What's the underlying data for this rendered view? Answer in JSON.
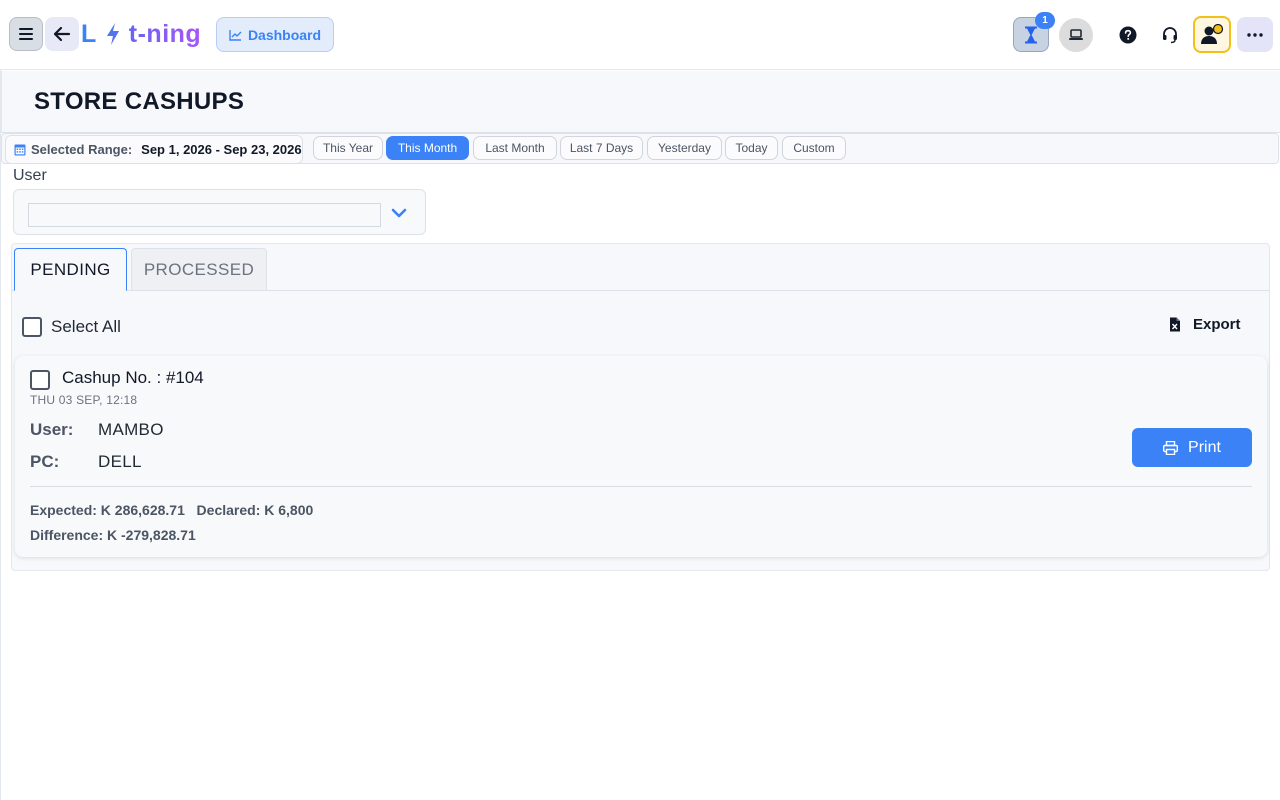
{
  "app": {
    "logo_part1": "L",
    "logo_part2": "t-ning",
    "dashboard_label": "Dashboard",
    "queue_badge": "1"
  },
  "icons": {
    "menu": "hamburger-icon",
    "back": "arrow-left-icon",
    "logo": "bolt-icon",
    "dashboard": "chart-line-icon",
    "queue": "hourglass-icon",
    "device": "laptop-icon",
    "help": "question-circle-icon",
    "support": "headset-icon",
    "user": "user-status-icon",
    "more": "ellipsis-icon",
    "calendar": "calendar-icon",
    "dropdown": "chevron-down-icon",
    "export": "excel-file-icon",
    "print": "printer-icon"
  },
  "colors": {
    "accent": "#3b82f6",
    "logo_gradient_start": "#6a63f2",
    "logo_gradient_end": "#a855f7",
    "user_status": "#f2c01c"
  },
  "page": {
    "title": "STORE CASHUPS"
  },
  "range": {
    "label": "Selected Range:",
    "value": "Sep 1, 2026 - Sep 23, 2026",
    "chips": [
      {
        "label": "This Year",
        "active": false
      },
      {
        "label": "This Month",
        "active": true
      },
      {
        "label": "Last Month",
        "active": false
      },
      {
        "label": "Last 7 Days",
        "active": false
      },
      {
        "label": "Yesterday",
        "active": false
      },
      {
        "label": "Today",
        "active": false
      },
      {
        "label": "Custom",
        "active": false
      }
    ]
  },
  "filter": {
    "user_label": "User",
    "user_value": "",
    "user_placeholder": ""
  },
  "tabs": [
    {
      "label": "PENDING",
      "active": true
    },
    {
      "label": "PROCESSED",
      "active": false
    }
  ],
  "list": {
    "select_all_label": "Select All",
    "export_label": "Export"
  },
  "cashup": {
    "title": "Cashup No. : #104",
    "date": "THU 03 SEP, 12:18",
    "user_key": "User:",
    "user_value": "MAMBO",
    "pc_key": "PC:",
    "pc_value": "DELL",
    "expected": "Expected: K 286,628.71",
    "declared": "Declared: K 6,800",
    "difference": "Difference: K -279,828.71",
    "print_label": "Print"
  }
}
